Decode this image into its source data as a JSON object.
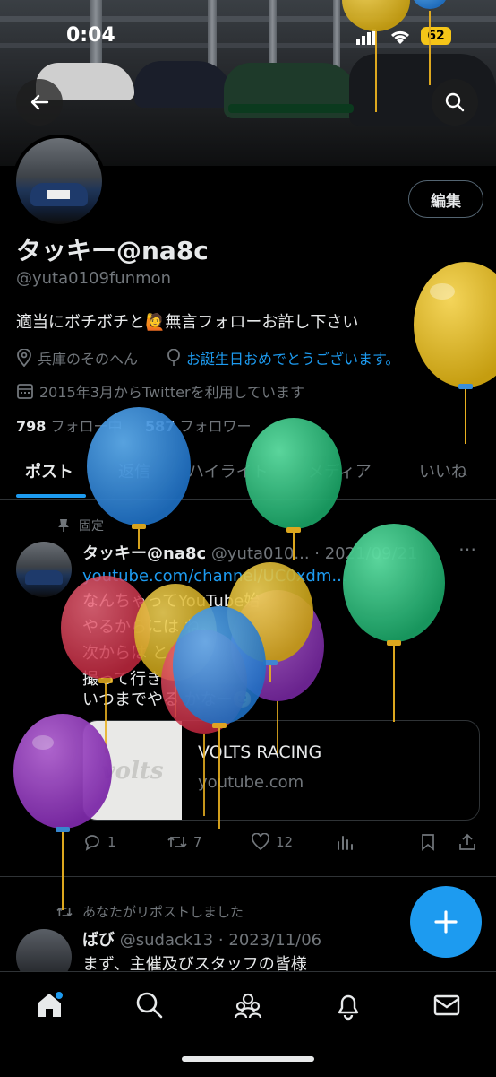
{
  "status_bar": {
    "time": "0:04",
    "battery": "62"
  },
  "profile": {
    "name": "タッキー@na8c",
    "handle": "@yuta0109funmon",
    "bio_before": "適当にボチボチと",
    "bio_emoji": "🙋",
    "bio_after": "無言フォローお許し下さい",
    "location": "兵庫のそのへん",
    "birthday": "お誕生日おめでとうございます。",
    "joined": "2015年3月からTwitterを利用しています",
    "following_count": "798",
    "following_label": "フォロー中",
    "followers_count": "587",
    "followers_label": "フォロワー",
    "edit_label": "編集"
  },
  "tabs": [
    {
      "label": "ポスト"
    },
    {
      "label": "返信"
    },
    {
      "label": "ハイライト"
    },
    {
      "label": "メディア"
    },
    {
      "label": "いいね"
    }
  ],
  "pinned_tweet": {
    "pinned_label": "固定",
    "name": "タッキー@na8c",
    "handle_date": "@yuta010... · 2021/09/21",
    "link": "youtube.com/channel/UC0xdm...",
    "lines": [
      "なんちゃってYouTube始",
      "やるからには      ね。",
      "次からは                  と",
      "撮って行き",
      "いつまでやる               かなー🙂"
    ],
    "card_title": "VOLTS RACING",
    "card_domain": "youtube.com",
    "card_logo": "volts",
    "replies": "1",
    "reposts": "7",
    "likes": "12"
  },
  "repost_tweet": {
    "repost_label": "あなたがリポストしました",
    "name": "ばび",
    "handle_date": "@sudack13 · 2023/11/06",
    "text": "まず、主催及びスタッフの皆様"
  },
  "colors": {
    "accent": "#1d9bf0",
    "background": "#000000",
    "muted": "#71767b"
  },
  "balloons": [
    "yellow",
    "blue",
    "yellow",
    "blue",
    "green",
    "green",
    "red",
    "yellow",
    "purple",
    "blue",
    "red",
    "yellow",
    "purple"
  ]
}
